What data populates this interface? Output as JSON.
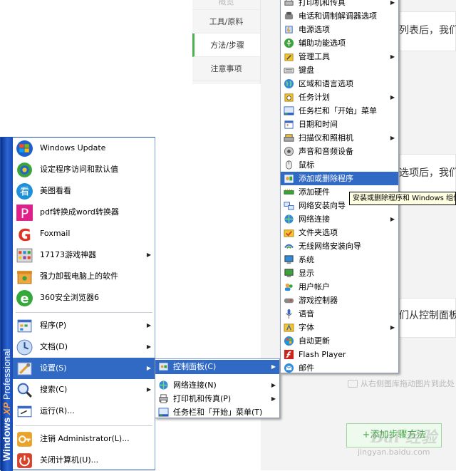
{
  "background_page": {
    "tabs": [
      "概览",
      "工具/原料",
      "方法/步骤",
      "注意事项"
    ],
    "text_lines": [
      "列表后，我们",
      "选项后，我们",
      "们从控制面板"
    ],
    "hint": "从右侧图库拖动图片到此处",
    "add_button": "+添加步骤方法",
    "watermark": "Bai 经验",
    "watermark_url": "jingyan.baidu.com"
  },
  "start_menu": {
    "band_text": {
      "windows": "Windows",
      "xp": "XP",
      "edition": "Professional"
    },
    "pinned_items": [
      {
        "label": "Windows Update",
        "icon": "windows-update-icon"
      },
      {
        "label": "设定程序访问和默认值",
        "icon": "program-defaults-icon"
      },
      {
        "label": "美图看看",
        "icon": "meitu-icon",
        "glyph": "看"
      },
      {
        "label": "pdf转换成word转换器",
        "icon": "pdf-converter-icon",
        "glyph": "P"
      },
      {
        "label": "Foxmail",
        "icon": "foxmail-icon",
        "glyph": "G"
      },
      {
        "label": "17173游戏神器",
        "icon": "game-tool-icon",
        "has_submenu": true
      },
      {
        "label": "强力卸载电脑上的软件",
        "icon": "uninstaller-icon"
      },
      {
        "label": "360安全浏览器6",
        "icon": "browser-360-icon",
        "glyph": "e"
      }
    ],
    "system_items": [
      {
        "label": "程序(P)",
        "icon": "programs-icon",
        "has_submenu": true
      },
      {
        "label": "文档(D)",
        "icon": "documents-icon",
        "has_submenu": true
      },
      {
        "label": "设置(S)",
        "icon": "settings-icon",
        "has_submenu": true,
        "highlighted": true
      },
      {
        "label": "搜索(C)",
        "icon": "search-icon",
        "has_submenu": true
      },
      {
        "label": "运行(R)...",
        "icon": "run-icon"
      }
    ],
    "session_items": [
      {
        "label": "注销 Administrator(L)...",
        "icon": "logoff-icon"
      },
      {
        "label": "关闭计算机(U)...",
        "icon": "shutdown-icon"
      }
    ]
  },
  "settings_submenu": {
    "items": [
      {
        "label": "控制面板(C)",
        "icon": "control-panel-icon",
        "has_submenu": true,
        "highlighted": true
      },
      {
        "label": "网络连接(N)",
        "icon": "network-icon",
        "has_submenu": true
      },
      {
        "label": "打印机和传真(P)",
        "icon": "printer-icon",
        "has_submenu": true
      },
      {
        "label": "任务栏和「开始」菜单(T)",
        "icon": "taskbar-icon"
      }
    ]
  },
  "control_panel_submenu": {
    "items": [
      {
        "label": "打印机和传真",
        "icon": "printer-icon",
        "has_submenu": true
      },
      {
        "label": "电话和调制解调器选项",
        "icon": "phone-modem-icon"
      },
      {
        "label": "电源选项",
        "icon": "power-icon"
      },
      {
        "label": "辅助功能选项",
        "icon": "accessibility-icon"
      },
      {
        "label": "管理工具",
        "icon": "admin-tools-icon",
        "has_submenu": true
      },
      {
        "label": "键盘",
        "icon": "keyboard-icon"
      },
      {
        "label": "区域和语言选项",
        "icon": "globe-icon"
      },
      {
        "label": "任务计划",
        "icon": "task-scheduler-icon",
        "has_submenu": true
      },
      {
        "label": "任务栏和「开始」菜单",
        "icon": "taskbar-icon"
      },
      {
        "label": "日期和时间",
        "icon": "calendar-icon"
      },
      {
        "label": "扫描仪和照相机",
        "icon": "scanner-icon",
        "has_submenu": true
      },
      {
        "label": "声音和音频设备",
        "icon": "sound-icon"
      },
      {
        "label": "鼠标",
        "icon": "mouse-icon"
      },
      {
        "label": "添加或删除程序",
        "icon": "add-remove-programs-icon",
        "highlighted": true
      },
      {
        "label": "添加硬件",
        "icon": "add-hardware-icon"
      },
      {
        "label": "网络安装向导",
        "icon": "network-setup-icon"
      },
      {
        "label": "网络连接",
        "icon": "network-icon",
        "has_submenu": true
      },
      {
        "label": "文件夹选项",
        "icon": "folder-options-icon"
      },
      {
        "label": "无线网络安装向导",
        "icon": "wireless-icon"
      },
      {
        "label": "系统",
        "icon": "system-icon"
      },
      {
        "label": "显示",
        "icon": "display-icon"
      },
      {
        "label": "用户帐户",
        "icon": "user-accounts-icon"
      },
      {
        "label": "游戏控制器",
        "icon": "game-controller-icon"
      },
      {
        "label": "语音",
        "icon": "speech-icon"
      },
      {
        "label": "字体",
        "icon": "fonts-icon",
        "has_submenu": true
      },
      {
        "label": "自动更新",
        "icon": "auto-update-icon"
      },
      {
        "label": "Flash Player",
        "icon": "flash-icon"
      },
      {
        "label": "邮件",
        "icon": "mail-icon"
      }
    ]
  },
  "tooltip": "安装或删除程序和 Windows 组件",
  "colors": {
    "highlight": "#316ac5",
    "xp_band": "#1a4bb5",
    "tooltip_bg": "#ffffe1"
  }
}
